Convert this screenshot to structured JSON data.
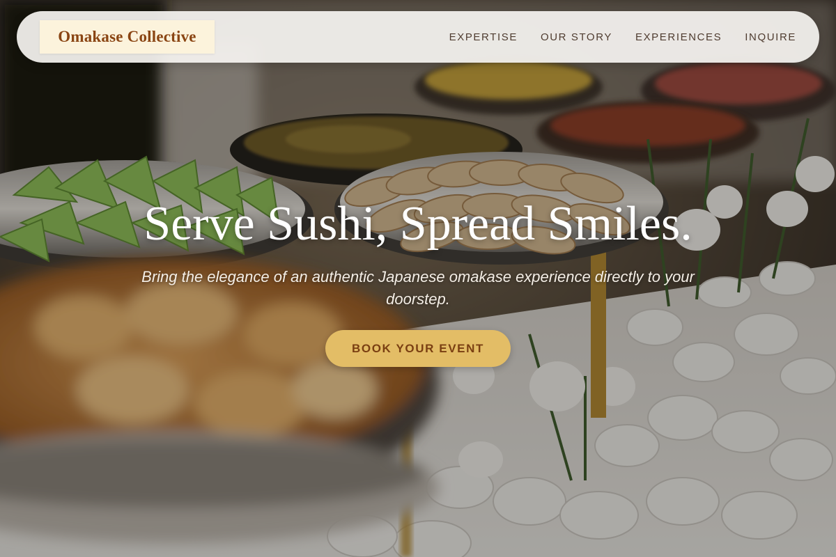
{
  "brand": {
    "name": "Omakase Collective"
  },
  "nav": {
    "links": [
      "EXPERTISE",
      "OUR STORY",
      "EXPERIENCES",
      "INQUIRE"
    ]
  },
  "hero": {
    "headline": "Serve Sushi, Spread Smiles.",
    "subtext": "Bring the elegance of an authentic Japanese omakase experience directly to your doorstep.",
    "cta_label": "BOOK YOUR EVENT",
    "background_image": "catering-buffet-photo"
  },
  "colors": {
    "logo_text": "#8a4513",
    "logo_bg": "#fcf3dc",
    "nav_text": "#4f3c30",
    "cta_bg": "#e3bd66",
    "cta_text": "#7a3f12"
  }
}
